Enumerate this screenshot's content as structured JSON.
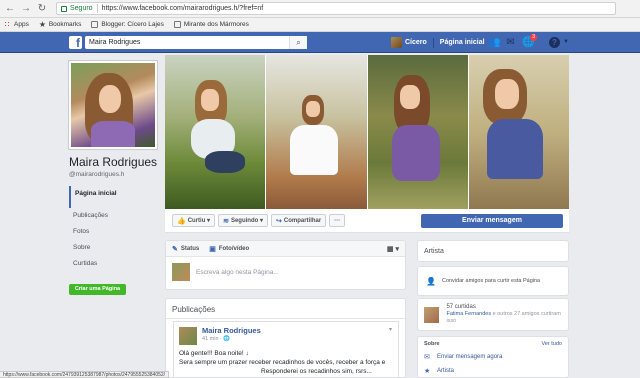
{
  "browser": {
    "secure_label": "Seguro",
    "url": "https://www.facebook.com/mairarodrigues.h/?fref=nf",
    "bookmarks": [
      {
        "label": "Apps",
        "icon": "apps-icon"
      },
      {
        "label": "Bookmarks",
        "icon": "star-icon"
      },
      {
        "label": "Blogger: Cícero Lajes",
        "icon": "page-icon"
      },
      {
        "label": "Mirante dos Mármores",
        "icon": "page-icon"
      }
    ],
    "status_url": "https://www.facebook.com/247939125387987/photos/247955525384052/"
  },
  "fb_header": {
    "search_value": "Maira Rodrigues",
    "user_name": "Cícero",
    "home_label": "Página inicial",
    "notifications_count": "3"
  },
  "profile": {
    "name": "Maira Rodrigues",
    "handle": "@mairarodrigues.h"
  },
  "left_nav": {
    "items": [
      "Página inicial",
      "Publicações",
      "Fotos",
      "Sobre",
      "Curtidas"
    ],
    "create_page": "Criar uma Página"
  },
  "actions": {
    "like": "Curtiu",
    "following": "Seguindo",
    "share": "Compartilhar",
    "more": "···",
    "send_message": "Enviar mensagem"
  },
  "composer": {
    "tab_status": "Status",
    "tab_photo": "Foto/vídeo",
    "placeholder": "Escreva algo nesta Página..."
  },
  "posts": {
    "title": "Publicações",
    "post": {
      "author": "Maira Rodrigues",
      "time": "41 min · ",
      "line1": "Olá gente!!! Boa noite! ↓",
      "line2": "Sera sempre um prazer receber recadinhos de vocês, receber a força e",
      "line3": "Responderei os recadinhos sim, rsrs..."
    }
  },
  "right": {
    "category": "Artista",
    "invite": "Convidar amigos para curtir esta Página",
    "likes_count": "57 curtidas",
    "likes_friend": "Fatima Fernandes",
    "likes_rest": " e outros 27 amigos curtiram isso",
    "about_title": "Sobre",
    "about_see_all": "Ver tudo",
    "send_message_now": "Enviar mensagem agora",
    "category_row": "Artista"
  }
}
